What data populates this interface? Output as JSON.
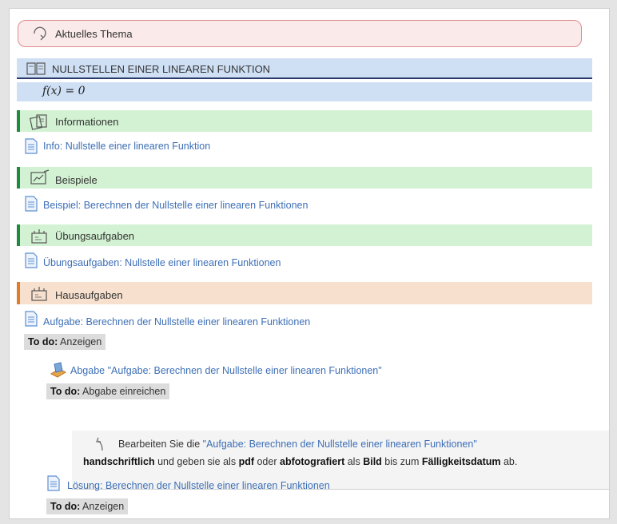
{
  "topic": {
    "label": "Aktuelles Thema"
  },
  "lesson": {
    "title": "NULLSTELLEN EINER LINEAREN FUNKTION",
    "formula": "f(x) = 0"
  },
  "sections": {
    "informationen": {
      "title": "Informationen",
      "link": "Info: Nullstelle einer linearen Funktion"
    },
    "beispiele": {
      "title": "Beispiele",
      "link": "Beispiel: Berechnen der Nullstelle einer linearen Funktionen"
    },
    "uebungsaufgaben": {
      "title": "Übungsaufgaben",
      "link": "Übungsaufgaben: Nullstelle einer linearen Funktionen"
    },
    "hausaufgaben": {
      "title": "Hausaufgaben",
      "link": "Aufgabe: Berechnen der Nullstelle einer linearen Funktionen",
      "todo_prefix": "To do:",
      "todo_value": "Anzeigen",
      "submission": {
        "link": "Abgabe \"Aufgabe: Berechnen der Nullstelle einer linearen Funktionen\"",
        "todo_prefix": "To do:",
        "todo_value": "Abgabe einreichen"
      },
      "note": {
        "t1": "Bearbeiten Sie die",
        "quoted": "\"Aufgabe: Berechnen der Nullstelle einer linearen Funktionen\"",
        "b1": "handschriftlich",
        "t2": "und geben sie als",
        "b2": "pdf",
        "t3": "oder",
        "b3": "abfotografiert",
        "t4": "als",
        "b4": "Bild",
        "t5": "bis zum",
        "b5": "Fälligkeitsdatum",
        "t6": "ab."
      },
      "solution": {
        "link": "Lösung: Berechnen der Nullstelle einer linearen Funktionen",
        "todo_prefix": "To do:",
        "todo_value": "Anzeigen"
      }
    }
  },
  "colors": {
    "link": "#3d6fb6",
    "green_accent": "#1d8a3d",
    "orange_accent": "#e47b26",
    "topic_border": "#e08b8b"
  }
}
